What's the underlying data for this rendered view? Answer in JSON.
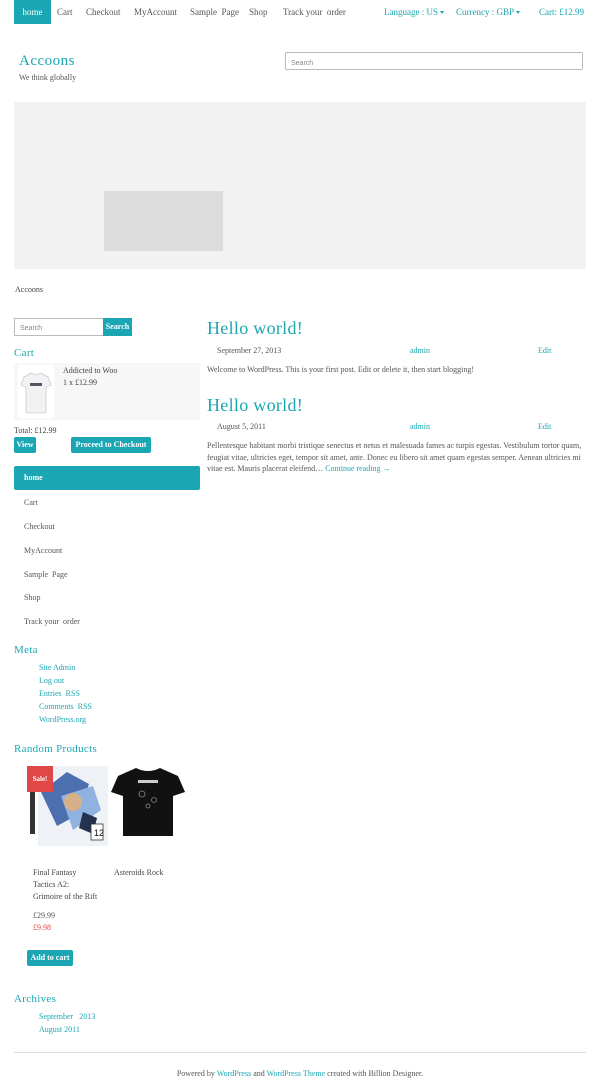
{
  "topnav": {
    "items": [
      "home",
      "Cart",
      "Checkout",
      "MyAccount",
      "Sample  Page",
      "Shop",
      "Track your  order"
    ],
    "language": "Language : US",
    "currency": "Currency : GBP",
    "cart": "Cart: £12.99"
  },
  "header": {
    "title": "Accoons",
    "tagline": "We think globally",
    "search_placeholder": "Search"
  },
  "breadcrumb": "Accoons",
  "sidebar": {
    "search_placeholder": "Search",
    "search_button": "Search",
    "cart_title": "Cart",
    "cart_item_name": "Addicted to Woo",
    "cart_item_qty": "1 x £12.99",
    "total": "Total: £12.99",
    "view_button": "View",
    "checkout_button": "Proceed to Checkout",
    "menu": [
      "home",
      "Cart",
      "Checkout",
      "MyAccount",
      "Sample  Page",
      "Shop",
      "Track your  order"
    ],
    "meta_title": "Meta",
    "meta_links": [
      "Site Admin",
      "Log out",
      "Entries  RSS",
      "Comments  RSS",
      "WordPress.org"
    ],
    "random_title": "Random Products",
    "sale_badge": "Sale!",
    "product1_name_line1": "Final Fantasy",
    "product1_name_line2": "Tactics A2:",
    "product1_name_line3": "Grimoire of the Rift",
    "product2_name": "Asteroids Rock",
    "product1_price_old": "£29.99",
    "product1_price_new": "£9.98",
    "add_to_cart": "Add to cart",
    "archives_title": "Archives",
    "archives": [
      "September   2013",
      "August 2011"
    ]
  },
  "posts": [
    {
      "title": "Hello world!",
      "date": "September 27, 2013",
      "author": "admin",
      "edit": "Edit",
      "body": "Welcome to WordPress. This is your first post. Edit or delete it, then start blogging!"
    },
    {
      "title": "Hello world!",
      "date": "August 5, 2011",
      "author": "admin",
      "edit": "Edit",
      "body": "Pellentesque habitant morbi tristique senectus et netus et malesuada fames ac turpis egestas. Vestibulum tortor quam, feugiat vitae, ultricies eget, tempor sit amet, ante. Donec eu libero sit amet quam egestas semper. Aenean ultricies mi vitae est. Mauris placerat eleifend…",
      "continue": "Continue reading →"
    }
  ],
  "footer": {
    "powered": "Powered by",
    "wp": "WordPress",
    "and": "and",
    "theme": "WordPress Theme",
    "created": "created with Billion Designer."
  },
  "colors": {
    "accent": "#1aa7b3",
    "sale": "#e04848"
  }
}
